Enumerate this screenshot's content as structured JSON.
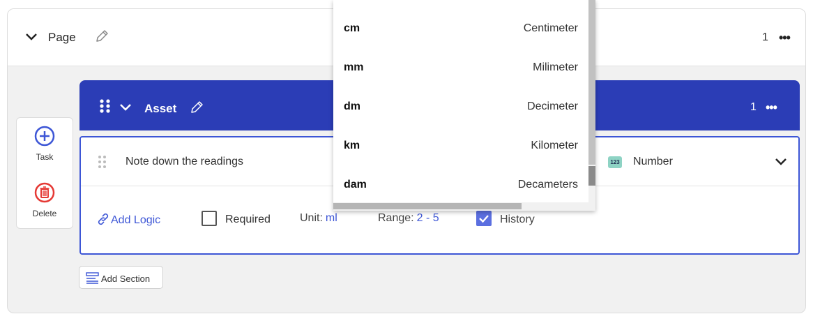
{
  "page": {
    "title": "Page",
    "count": "1",
    "more": "•••"
  },
  "tools": {
    "task_label": "Task",
    "delete_label": "Delete"
  },
  "section": {
    "title": "Asset",
    "count": "1",
    "more": "•••",
    "color": "#2b3db6"
  },
  "question": {
    "text": "Note down the readings",
    "type_badge": "123",
    "type_label": "Number",
    "add_logic_label": "Add Logic",
    "required_label": "Required",
    "required_checked": false,
    "unit_label": "Unit:",
    "unit_value": "ml",
    "range_label": "Range:",
    "range_value": "2 - 5",
    "history_label": "History",
    "history_checked": true
  },
  "add_section_label": "Add Section",
  "unit_dropdown": {
    "options": [
      {
        "code": "cm",
        "name": "Centimeter"
      },
      {
        "code": "mm",
        "name": "Milimeter"
      },
      {
        "code": "dm",
        "name": "Decimeter"
      },
      {
        "code": "km",
        "name": "Kilometer"
      },
      {
        "code": "dam",
        "name": "Decameters"
      }
    ]
  },
  "colors": {
    "accent": "#3d56d6",
    "delete": "#e53935",
    "badge": "#8ed3c4"
  },
  "icons": {
    "page_chevron": "chevron-down-icon",
    "page_edit": "pencil-icon",
    "task": "plus-circle-icon",
    "delete": "trash-circle-icon",
    "drag": "drag-handle-icon",
    "logic": "link-icon",
    "check": "check-icon",
    "add_section": "section-list-icon"
  }
}
